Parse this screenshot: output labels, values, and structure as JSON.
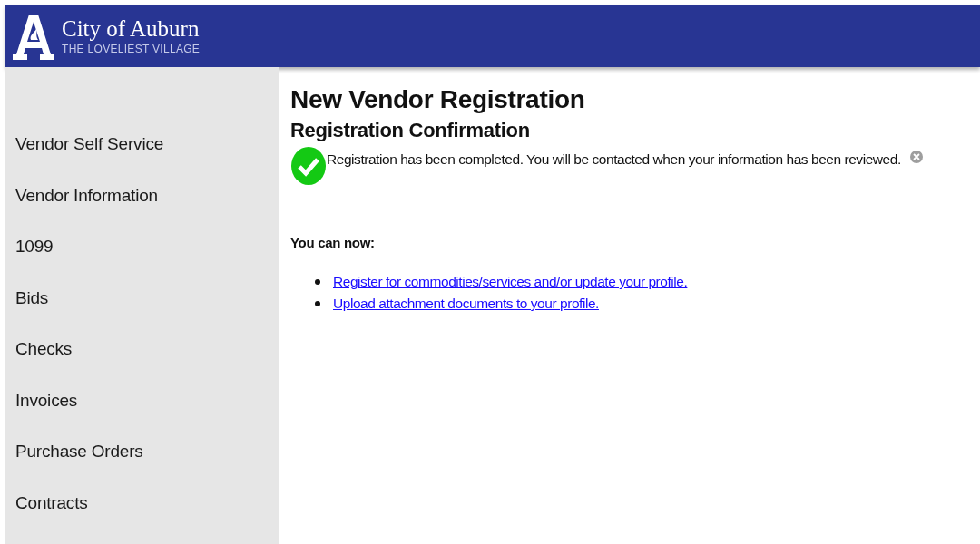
{
  "header": {
    "title": "City of Auburn",
    "tagline": "THE LOVELIEST VILLAGE"
  },
  "sidebar": {
    "items": [
      "Vendor Self Service",
      "Vendor Information",
      "1099",
      "Bids",
      "Checks",
      "Invoices",
      "Purchase Orders",
      "Contracts"
    ]
  },
  "main": {
    "title": "New Vendor Registration",
    "subtitle": "Registration Confirmation",
    "message": "Registration has been completed. You will be contacted when your information has been reviewed.",
    "next_heading": "You can now:",
    "links": [
      "Register for commodities/services and/or update your profile.",
      "Upload attachment documents to your profile."
    ]
  }
}
